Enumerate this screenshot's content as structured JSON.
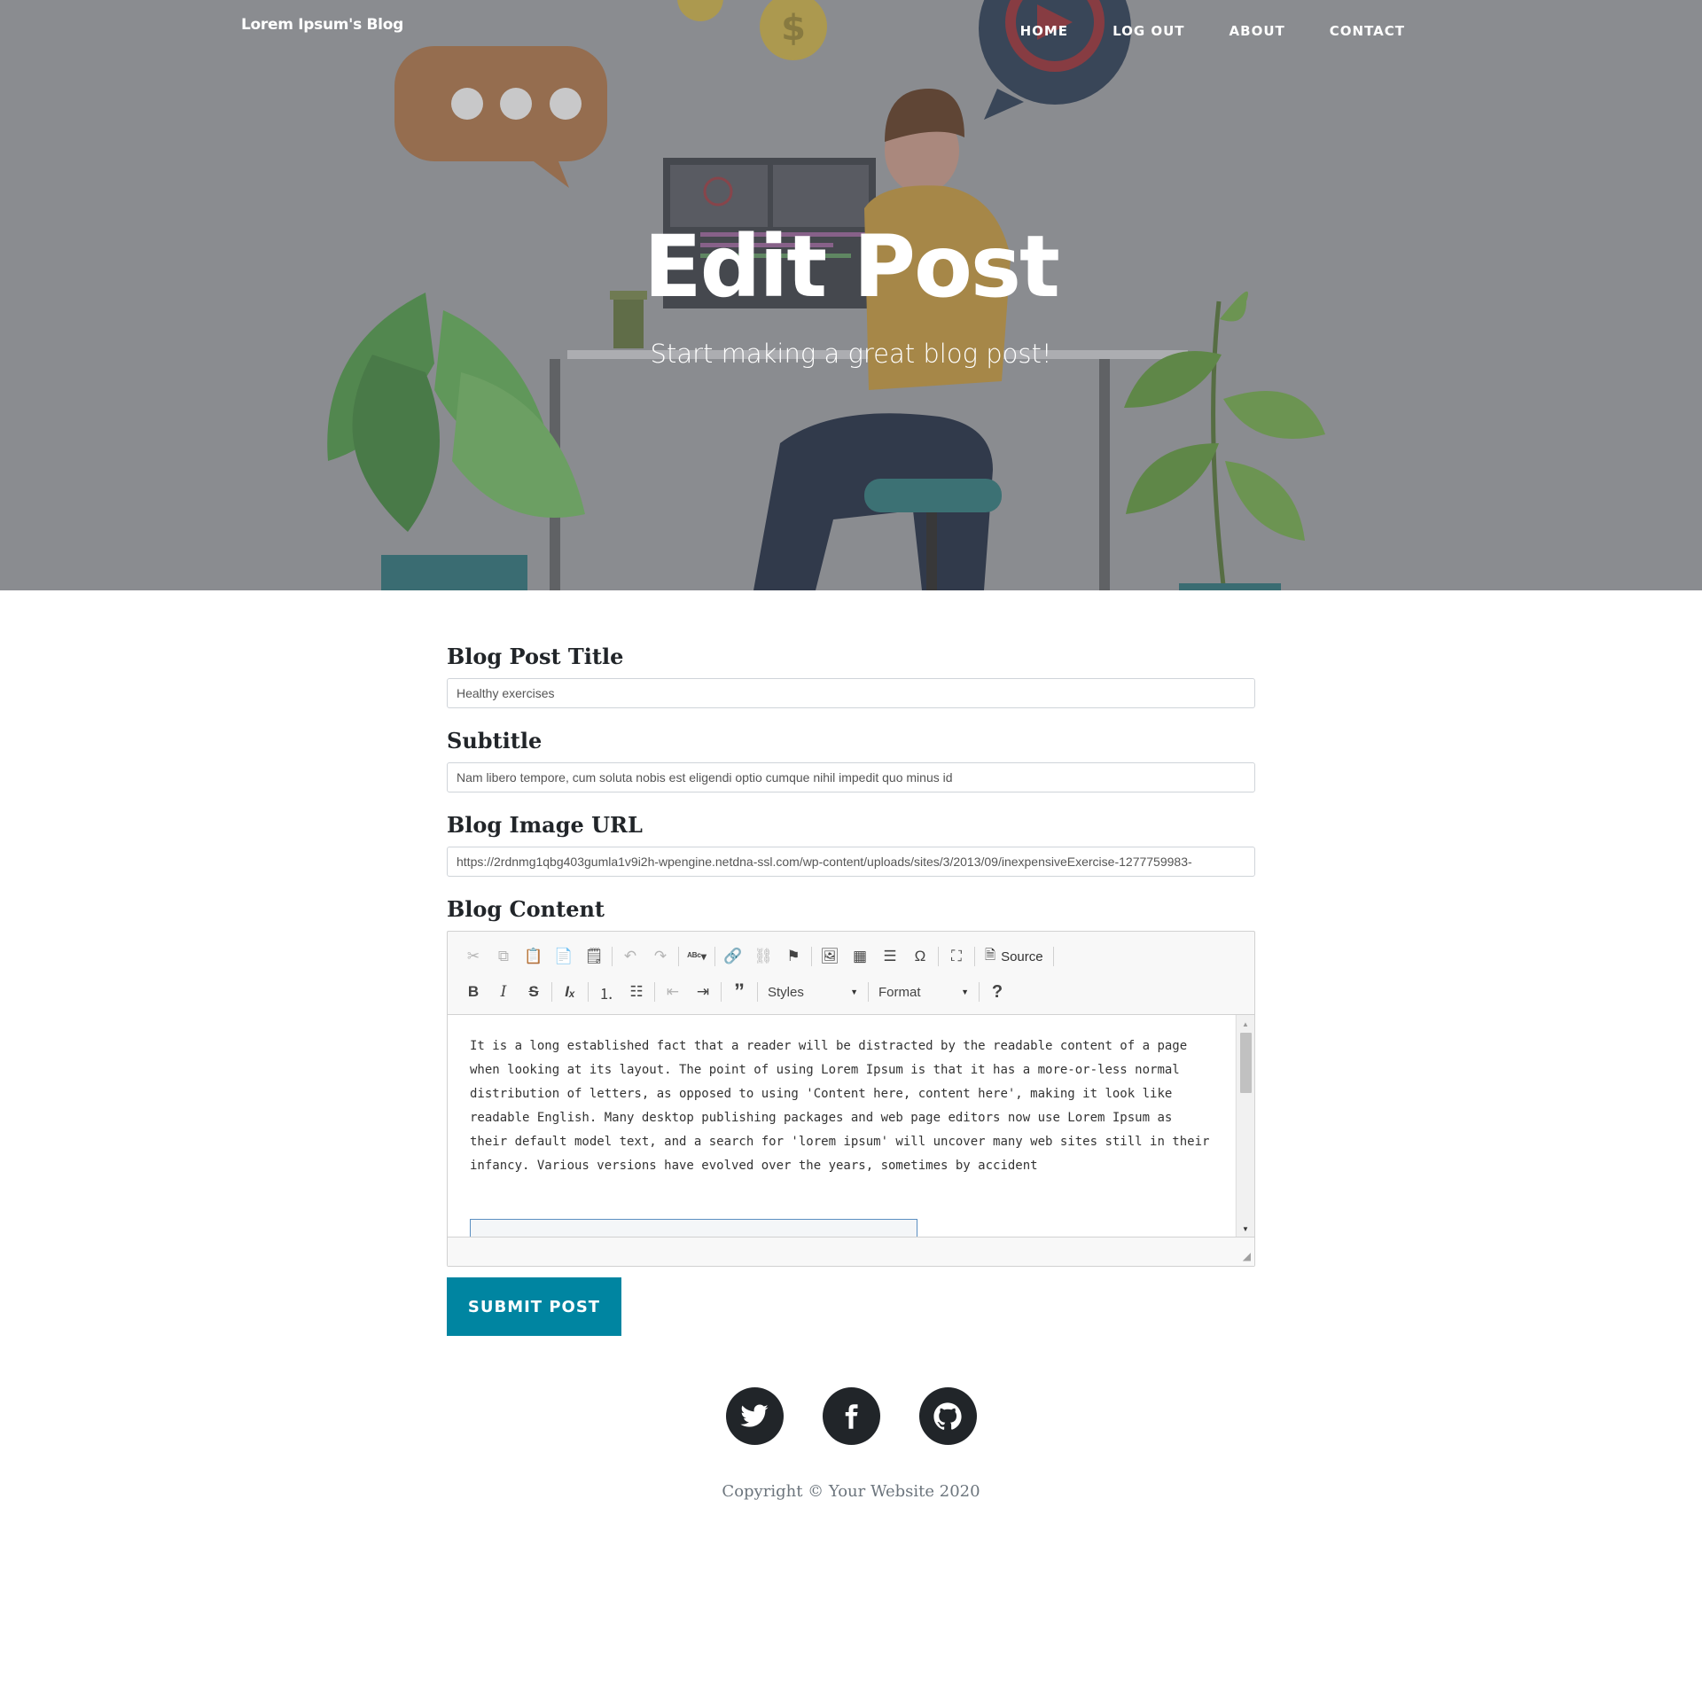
{
  "navbar": {
    "brand": "Lorem Ipsum's Blog",
    "links": [
      "HOME",
      "LOG OUT",
      "ABOUT",
      "CONTACT"
    ]
  },
  "hero": {
    "title": "Edit Post",
    "subtitle": "Start making a great blog post!"
  },
  "form": {
    "title_label": "Blog Post Title",
    "title_value": "Healthy exercises",
    "subtitle_label": "Subtitle",
    "subtitle_value": "Nam libero tempore, cum soluta nobis est eligendi optio cumque nihil impedit quo minus id",
    "image_label": "Blog Image URL",
    "image_value": "https://2rdnmg1qbg403gumla1v9i2h-wpengine.netdna-ssl.com/wp-content/uploads/sites/3/2013/09/inexpensiveExercise-1277759983-",
    "content_label": "Blog Content",
    "submit_label": "SUBMIT POST"
  },
  "editor": {
    "source_label": "Source",
    "styles_label": "Styles",
    "format_label": "Format",
    "content": "It is a long established fact that a reader will be distracted by the readable content of a page when looking at its layout. The point of using Lorem Ipsum is that it has a more-or-less normal distribution of letters, as opposed to using 'Content here, content here', making it look like readable English. Many desktop publishing packages and web page editors now use Lorem Ipsum as their default model text, and a search for 'lorem ipsum' will uncover many web sites still in their infancy. Various versions have evolved over the years, sometimes by accident"
  },
  "footer": {
    "social": [
      "twitter-icon",
      "facebook-icon",
      "github-icon"
    ],
    "copyright": "Copyright © Your Website 2020"
  },
  "colors": {
    "accent": "#0085a1",
    "dark": "#212529",
    "hero_overlay": "#8d8f93"
  }
}
